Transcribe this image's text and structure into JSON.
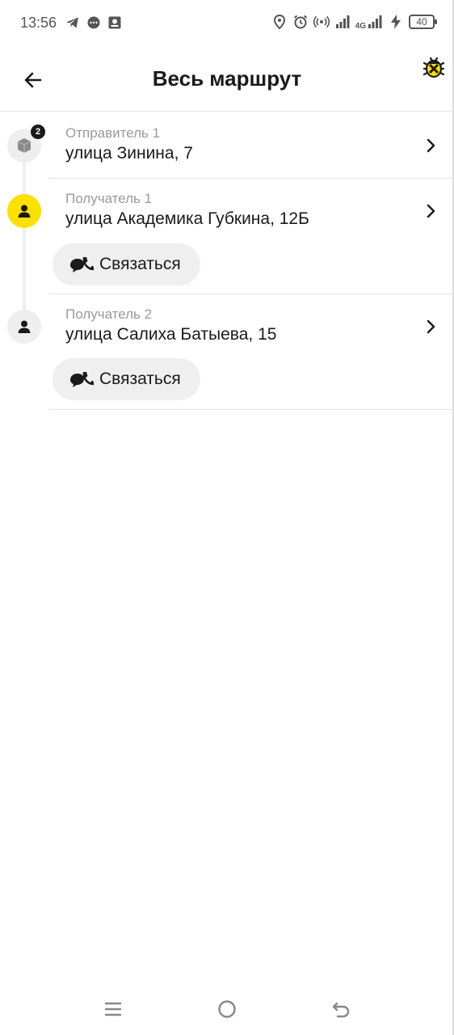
{
  "status_bar": {
    "time": "13:56",
    "battery": "40",
    "network": "4G",
    "left_icons": [
      "telegram-icon",
      "chat-bubble-icon",
      "app-badge-icon"
    ],
    "right_icons": [
      "location-pin-icon",
      "alarm-icon",
      "hotspot-icon",
      "signal-icon",
      "signal-4g-icon",
      "charging-icon",
      "battery-icon"
    ]
  },
  "header": {
    "title": "Весь маршрут",
    "back_icon": "arrow-left-icon",
    "debug_icon": "bug-icon"
  },
  "route": {
    "stops": [
      {
        "label": "Отправитель 1",
        "address": "улица Зинина, 7",
        "icon": "package-icon",
        "badge": "2",
        "active": false
      },
      {
        "label": "Получатель 1",
        "address": "улица Академика Губкина, 12Б",
        "icon": "person-icon",
        "active": true,
        "contact_label": "Связаться"
      },
      {
        "label": "Получатель 2",
        "address": "улица Салиха Батыева, 15",
        "icon": "person-icon",
        "active": false,
        "contact_label": "Связаться"
      }
    ]
  },
  "colors": {
    "accent_yellow": "#fce000",
    "marker_gray": "#eeeeee",
    "label_gray": "#9a9a9a",
    "text": "#1a1a1a"
  },
  "nav_bar": {
    "buttons": [
      "menu-icon",
      "home-circle-icon",
      "back-return-icon"
    ]
  }
}
